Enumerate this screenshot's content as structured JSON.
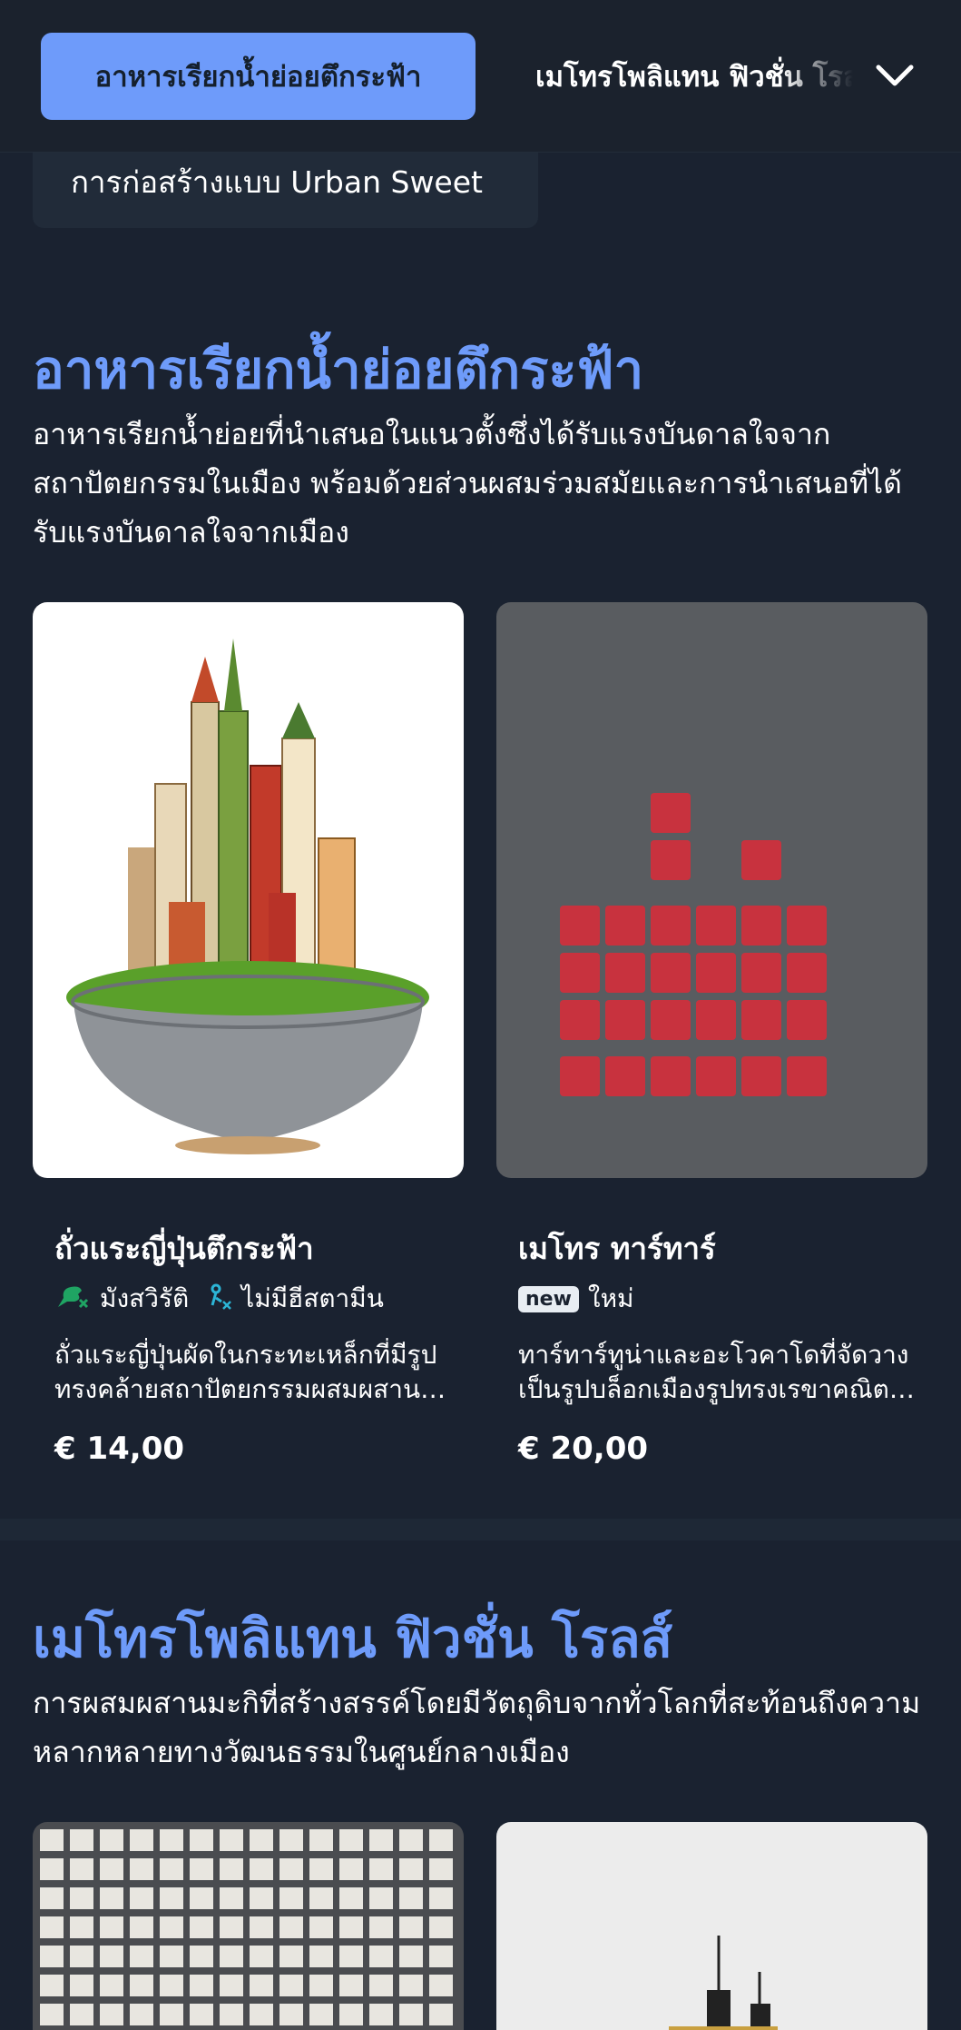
{
  "tabs": {
    "active": "อาหารเรียกน้ำย่อยตึกระฟ้า",
    "next": "เมโทรโพลิแทน ฟิวชั่น โรลส์"
  },
  "chip": {
    "label": "การก่อสร้างแบบ Urban Sweet"
  },
  "section1": {
    "title": "อาหารเรียกน้ำย่อยตึกระฟ้า",
    "description": "อาหารเรียกน้ำย่อยที่นำเสนอในแนวตั้งซึ่งได้รับแรงบันดาลใจจากสถาปัตยกรรมในเมือง พร้อมด้วยส่วนผสมร่วมสมัยและการนำเสนอที่ได้รับแรงบันดาลใจจากเมือง",
    "items": [
      {
        "name": "ถั่วแระญี่ปุ่นตึกระฟ้า",
        "tags": [
          {
            "icon": "vegan-icon",
            "label": "มังสวิรัติ"
          },
          {
            "icon": "no-histamine-icon",
            "label": "ไม่มีฮีสตามีน"
          }
        ],
        "description": "ถั่วแระญี่ปุ่นผัดในกระทะเหล็กที่มีรูปทรงคล้ายสถาปัตยกรรมผสมผสานกับเส้นขอบฟ้าของเมือง",
        "price": "€ 14,00"
      },
      {
        "name": "เมโทร ทาร์ทาร์",
        "tags": [
          {
            "icon": "new-badge",
            "badge": "new",
            "label": "ใหม่"
          }
        ],
        "description": "ทาร์ทาร์ทูน่าและอะโวคาโดที่จัดวางเป็นรูปบล็อกเมืองรูปทรงเรขาคณิตที่ทันสมัย",
        "price": "€ 20,00"
      }
    ]
  },
  "section2": {
    "title": "เมโทรโพลิแทน ฟิวชั่น โรลส์",
    "description": "การผสมผสานมะกิที่สร้างสรรค์โดยมีวัตถุดิบจากทั่วโลกที่สะท้อนถึงความหลากหลายทางวัฒนธรรมในศูนย์กลางเมือง"
  },
  "colors": {
    "background": "#1a2230",
    "accent": "#6e9bfa",
    "vegan": "#1fa463",
    "no_histamine": "#2cb5d6"
  }
}
